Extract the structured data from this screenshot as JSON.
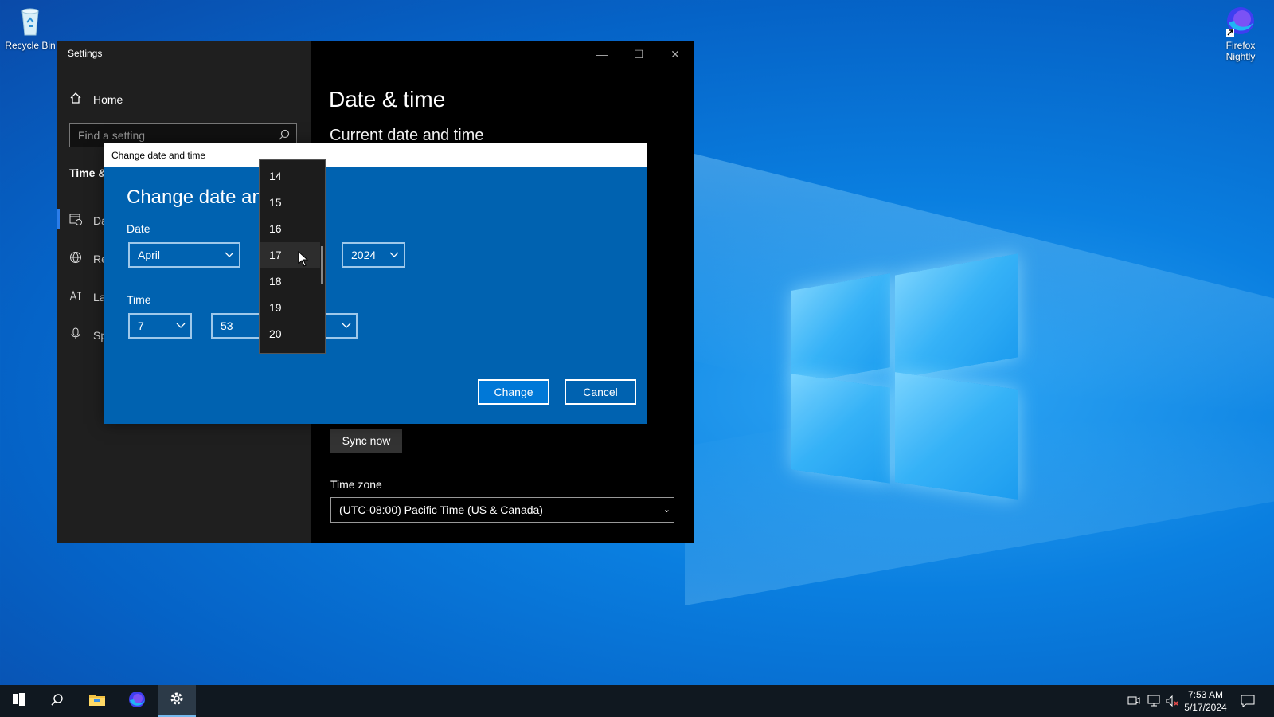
{
  "desktop": {
    "icons": [
      {
        "label": "Recycle Bin",
        "icon": "recycle-bin-icon"
      },
      {
        "label": "Firefox Nightly",
        "icon": "firefox-nightly-icon"
      }
    ]
  },
  "settings_window": {
    "title": "Settings",
    "controls": {
      "minimize": "—",
      "maximize": "☐",
      "close": "✕"
    },
    "sidebar": {
      "home_label": "Home",
      "search_placeholder": "Find a setting",
      "group_title": "Time &",
      "items": [
        {
          "label": "Da",
          "icon": "calendar-clock-icon"
        },
        {
          "label": "Re",
          "icon": "globe-icon"
        },
        {
          "label": "La",
          "icon": "language-icon"
        },
        {
          "label": "Sp",
          "icon": "microphone-icon"
        }
      ]
    },
    "main": {
      "page_title": "Date & time",
      "section_title": "Current date and time",
      "sync_button": "Sync now",
      "time_zone_label": "Time zone",
      "time_zone_value": "(UTC-08:00) Pacific Time (US & Canada)"
    }
  },
  "dialog": {
    "window_title": "Change date and time",
    "heading": "Change date and",
    "date_label": "Date",
    "month_value": "April",
    "year_value": "2024",
    "time_label": "Time",
    "hour_value": "7",
    "minute_value": "53",
    "change_button": "Change",
    "cancel_button": "Cancel"
  },
  "day_dropdown": {
    "options": [
      "14",
      "15",
      "16",
      "17",
      "18",
      "19",
      "20"
    ],
    "selected": "17"
  },
  "taskbar": {
    "items": [
      "start-icon",
      "search-icon",
      "file-explorer-icon",
      "firefox-icon",
      "settings-icon"
    ],
    "time": "7:53 AM",
    "date": "5/17/2024"
  },
  "colors": {
    "desktop_blue": "#0a7fe0",
    "dialog_blue": "#0062b0",
    "accent": "#0078d7",
    "window_bg": "#000000",
    "sidebar_bg": "#1f1f1f"
  }
}
